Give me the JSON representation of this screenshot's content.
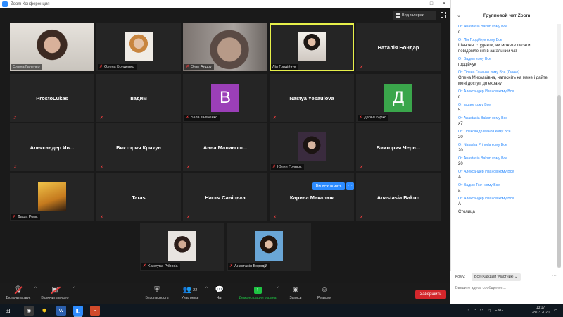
{
  "window": {
    "title": "Zoom Конференция",
    "controls": [
      "–",
      "□",
      "✕"
    ]
  },
  "meeting": {
    "view_toggle_label": "Вид галереи",
    "tiles": [
      {
        "row": 0,
        "col": 0,
        "kind": "video",
        "face": "face-a",
        "label": "Олена Ганенко",
        "mic_off": false,
        "active": false
      },
      {
        "row": 0,
        "col": 1,
        "kind": "photo",
        "face": "face-b",
        "label": "Олена Бонденко",
        "mic_off": true,
        "active": false
      },
      {
        "row": 0,
        "col": 2,
        "kind": "video",
        "face": "face-c",
        "label": "Олег Андру",
        "mic_off": true,
        "active": false
      },
      {
        "row": 0,
        "col": 3,
        "kind": "photo-center",
        "face": "face-d",
        "label": "Лія Гордійчук",
        "mic_off": false,
        "active": true
      },
      {
        "row": 0,
        "col": 4,
        "kind": "name",
        "big": "Наталія Бондар",
        "mic_off": true
      },
      {
        "row": 1,
        "col": 0,
        "kind": "name",
        "big": "ProstoLukas",
        "mic_off": true
      },
      {
        "row": 1,
        "col": 1,
        "kind": "name",
        "big": "вадим",
        "mic_off": true
      },
      {
        "row": 1,
        "col": 2,
        "kind": "avatar",
        "letter": "В",
        "color": "#9b3fb8",
        "label": "Бэла Дьяченко",
        "mic_off": true
      },
      {
        "row": 1,
        "col": 3,
        "kind": "name",
        "big": "Nastya Yesaulova",
        "mic_off": true
      },
      {
        "row": 1,
        "col": 4,
        "kind": "avatar",
        "letter": "Д",
        "color": "#3aa64b",
        "label": "Дарья Бурко",
        "mic_off": true
      },
      {
        "row": 2,
        "col": 0,
        "kind": "name",
        "big": "Александер Ив...",
        "mic_off": true
      },
      {
        "row": 2,
        "col": 1,
        "kind": "name",
        "big": "Виктория Крикун",
        "mic_off": true
      },
      {
        "row": 2,
        "col": 2,
        "kind": "name",
        "big": "Анна Малинош...",
        "mic_off": true
      },
      {
        "row": 2,
        "col": 3,
        "kind": "photo-center",
        "face": "face-e",
        "label": "Юлия Гринюк",
        "mic_off": true,
        "active": false
      },
      {
        "row": 2,
        "col": 4,
        "kind": "name",
        "big": "Виктория Черн...",
        "mic_off": true
      },
      {
        "row": 3,
        "col": 0,
        "kind": "photo-center",
        "face": "face-f",
        "label": "Даша Ромк",
        "mic_off": true,
        "active": false
      },
      {
        "row": 3,
        "col": 1,
        "kind": "name",
        "big": "Taras",
        "mic_off": true
      },
      {
        "row": 3,
        "col": 2,
        "kind": "name",
        "big": "Настя Савіцька",
        "mic_off": true
      },
      {
        "row": 3,
        "col": 3,
        "kind": "name",
        "big": "Карина Макалюк",
        "mic_off": true
      },
      {
        "row": 3,
        "col": 4,
        "kind": "name",
        "big": "Anastasia Bakun",
        "mic_off": true
      },
      {
        "row": 4,
        "col": 0,
        "kind": "photo-center",
        "face": "face-g",
        "label": "Kateryna Prihoda",
        "mic_off": true,
        "active": false
      },
      {
        "row": 4,
        "col": 1,
        "kind": "photo-center",
        "face": "face-h",
        "label": "Анастасія Бородій",
        "mic_off": true,
        "active": false
      }
    ],
    "popup_label": "Включить звук",
    "popup_more": "···"
  },
  "toolbar": {
    "unmute_label": "Включить звук",
    "start_video_label": "Включить видео",
    "security_label": "Безопасность",
    "participants_label": "Участники",
    "participants_count": "22",
    "chat_label": "Чат",
    "share_label": "Демонстрация экрана",
    "record_label": "Запись",
    "reactions_label": "Реакции",
    "end_label": "Завершить"
  },
  "chat": {
    "title": "Групповой чат Zoom",
    "messages": [
      {
        "from": "От Anastasia Bakun кому Все",
        "text": "я"
      },
      {
        "from": "От Лія Гордійчук кому Все",
        "text": "Шановні студенти, ви можете писати повідомлення в загальний чат"
      },
      {
        "from": "От Вадим кому Все",
        "text": "гордійчук"
      },
      {
        "from": "От Олена Ганенко кому Все (Лично)",
        "text": "Олена Миколаївна, натисніть на мене і дайте мені доступ до екрану"
      },
      {
        "from": "От Александер Иванов кому Все",
        "text": "я"
      },
      {
        "from": "От вадим кому Все",
        "text": "5"
      },
      {
        "from": "От Anastasia Bakun кому Все",
        "text": "я7"
      },
      {
        "from": "От Олександр Іванов кому Все",
        "text": "20"
      },
      {
        "from": "От Natasha Prihoda кому Все",
        "text": "20"
      },
      {
        "from": "От Anastasia Bakun кому Все",
        "text": "20"
      },
      {
        "from": "От Александер Иванов кому Все",
        "text": "А"
      },
      {
        "from": "От Вадим Ткач кому Все",
        "text": "а"
      },
      {
        "from": "От Александер Иванов кому Все",
        "text": "А"
      },
      {
        "from": "",
        "text": "Столица"
      }
    ],
    "to_label": "Кому:",
    "to_value": "Все (Каждый участник)",
    "input_placeholder": "Введите здесь сообщение...",
    "more_label": "···"
  },
  "taskbar": {
    "apps": [
      "⊞",
      "◉",
      "⬢",
      "W",
      "◧",
      "P"
    ],
    "lang": "ENG",
    "time": "13:17",
    "date": "28.03.2020"
  }
}
